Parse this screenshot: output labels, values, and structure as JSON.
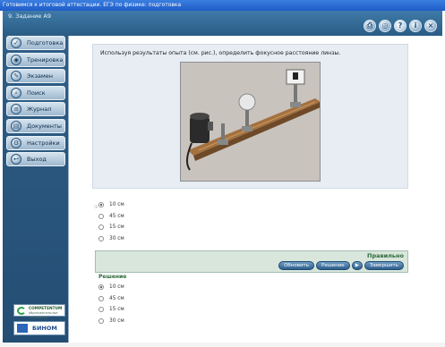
{
  "window": {
    "title": "Готовимся к итоговой аттестации. ЕГЭ по физике: подготовка"
  },
  "header": {
    "task_title": "9. Задание А9",
    "icons": [
      "print-icon",
      "settings-icon",
      "help-icon",
      "info-icon",
      "close-icon"
    ],
    "help_glyph": "?",
    "info_glyph": "i",
    "close_glyph": "×"
  },
  "sidebar": {
    "items": [
      {
        "label": "Подготовка",
        "icon": "check-icon",
        "glyph": "✓"
      },
      {
        "label": "Тренировка",
        "icon": "target-icon",
        "glyph": "◉"
      },
      {
        "label": "Экзамен",
        "icon": "exam-icon",
        "glyph": "✎"
      },
      {
        "label": "Поиск",
        "icon": "search-icon",
        "glyph": "⌕"
      },
      {
        "label": "Журнал",
        "icon": "journal-icon",
        "glyph": "≡"
      },
      {
        "label": "Документы",
        "icon": "documents-icon",
        "glyph": "▤"
      },
      {
        "label": "Настройки",
        "icon": "gear-icon",
        "glyph": "⚙"
      },
      {
        "label": "Выход",
        "icon": "exit-icon",
        "glyph": "↩"
      }
    ]
  },
  "logos": {
    "competentum": "COMPETENTUM",
    "competentum_sub": "образовательные технологии",
    "binom": "БИНОМ"
  },
  "question": {
    "text": "Используя результаты опыта (см. рис.), определить фокусное расстояние линзы."
  },
  "options": [
    {
      "label": "10 см",
      "selected": true
    },
    {
      "label": "45 см",
      "selected": false
    },
    {
      "label": "15 см",
      "selected": false
    },
    {
      "label": "30 см",
      "selected": false
    }
  ],
  "result": {
    "status": "Правильно",
    "buttons": [
      "Обновить",
      "Решение",
      "▶",
      "Завершить"
    ]
  },
  "solution": {
    "label": "Решение",
    "options": [
      {
        "label": "10 см",
        "checked": true
      },
      {
        "label": "45 см",
        "checked": false
      },
      {
        "label": "15 см",
        "checked": false
      },
      {
        "label": "30 см",
        "checked": false
      }
    ]
  },
  "colors": {
    "frame": "#2f5f88",
    "correct": "#2d6a3a",
    "button": "#2f5f8c"
  }
}
